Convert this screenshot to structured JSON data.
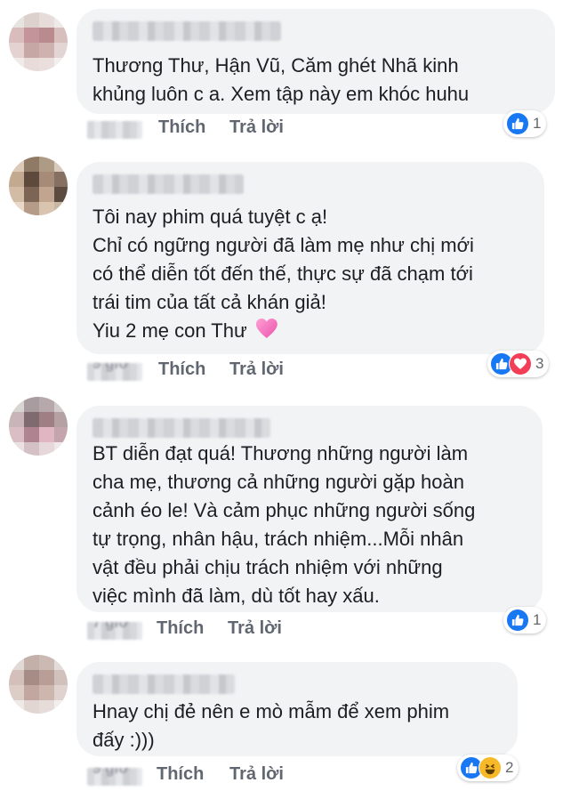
{
  "comments": [
    {
      "text_lines": [
        "Thương Thư,  Hận Vũ,  Căm ghét  Nhã kinh",
        "khủng luôn c a. Xem tập này em khóc huhu"
      ],
      "time": "",
      "like_label": "Thích",
      "reply_label": "Trả lời",
      "reaction_icons": [
        "like-icon"
      ],
      "reaction_count": "1"
    },
    {
      "text_lines": [
        "Tôi nay phim quá tuyệt c ạ!",
        "Chỉ có ngững người đã làm mẹ như chị mới",
        "có thể diễn tốt đến thế, thực sự đã chạm tới",
        "trái tim của tất cả khán giả!"
      ],
      "extra_line": "Yiu 2 mẹ con Thư",
      "time": "9 giờ",
      "like_label": "Thích",
      "reply_label": "Trả lời",
      "reaction_icons": [
        "like-icon",
        "love-icon"
      ],
      "reaction_count": "3"
    },
    {
      "text_lines": [
        "BT diễn đạt quá! Thương những người làm",
        "cha mẹ, thương cả những người gặp hoàn",
        "cảnh éo le! Và cảm phục những người sống",
        "tự trọng, nhân hậu, trách nhiệm...Mỗi nhân",
        "vật đều phải chịu trách nhiệm với những",
        "việc mình đã làm, dù tốt hay xấu."
      ],
      "time": "7 giờ",
      "like_label": "Thích",
      "reply_label": "Trả lời",
      "reaction_icons": [
        "like-icon"
      ],
      "reaction_count": "1"
    },
    {
      "text_lines": [
        "Hnay chị đẻ nên e mò mẫm để xem phim",
        "đấy :)))"
      ],
      "time": "9 giờ",
      "like_label": "Thích",
      "reply_label": "Trả lời",
      "reaction_icons": [
        "like-icon",
        "haha-icon"
      ],
      "reaction_count": "2"
    }
  ],
  "colors": {
    "bubble": "#f2f3f5",
    "text": "#1c1e21",
    "action": "#606770",
    "like": "#1877f2",
    "love": "#f33e58",
    "haha": "#f7b928"
  }
}
